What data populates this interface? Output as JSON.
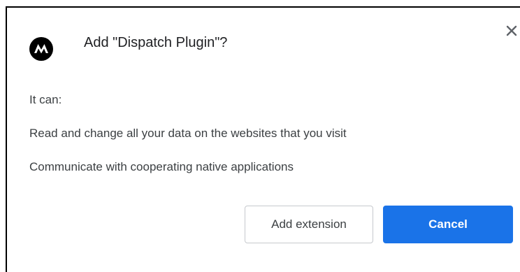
{
  "dialog": {
    "title": "Add \"Dispatch Plugin\"?",
    "logo_icon": "motorola-logo-icon",
    "close_icon": "close-icon",
    "intro": "It can:",
    "permissions": [
      "Read and change all your data on the websites that you visit",
      "Communicate with cooperating native applications"
    ],
    "buttons": {
      "add_label": "Add extension",
      "cancel_label": "Cancel"
    }
  },
  "colors": {
    "accent": "#1a73e8",
    "text": "#202124",
    "secondary_text": "#3c4043",
    "button_border": "#c6c9cd"
  }
}
